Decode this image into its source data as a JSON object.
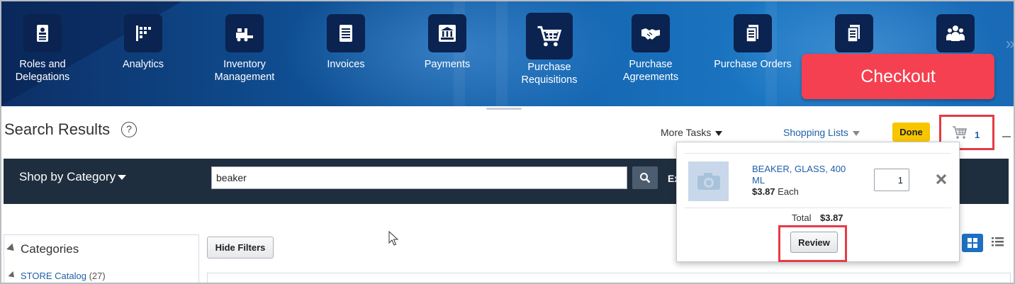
{
  "nav": {
    "items": [
      {
        "label_line1": "Roles and",
        "label_line2": "Delegations",
        "icon": "roles-delegations-icon"
      },
      {
        "label_line1": "Analytics",
        "label_line2": "",
        "icon": "analytics-icon"
      },
      {
        "label_line1": "Inventory",
        "label_line2": "Management",
        "icon": "inventory-icon"
      },
      {
        "label_line1": "Invoices",
        "label_line2": "",
        "icon": "invoices-icon"
      },
      {
        "label_line1": "Payments",
        "label_line2": "",
        "icon": "payments-icon"
      },
      {
        "label_line1": "Purchase",
        "label_line2": "Requisitions",
        "icon": "cart-icon"
      },
      {
        "label_line1": "Purchase",
        "label_line2": "Agreements",
        "icon": "handshake-icon"
      },
      {
        "label_line1": "Purchase Orders",
        "label_line2": "",
        "icon": "document-icon"
      },
      {
        "label_line1": "",
        "label_line2": "",
        "icon": "document-icon"
      },
      {
        "label_line1": "",
        "label_line2": "",
        "icon": "team-icon"
      }
    ],
    "more_glyph": "»"
  },
  "annotation": {
    "checkout_label": "Checkout"
  },
  "header": {
    "title": "Search Results",
    "help_glyph": "?",
    "more_tasks": "More Tasks",
    "shopping_lists": "Shopping Lists",
    "done": "Done",
    "cart_count": "1"
  },
  "search": {
    "category_label": "Shop by Category",
    "value": "beaker",
    "extra_label": "Ex"
  },
  "filters": {
    "hide_filters": "Hide Filters",
    "categories_title": "Categories",
    "items": [
      {
        "label": "STORE Catalog",
        "count": "(27)"
      }
    ]
  },
  "cart_popup": {
    "item": {
      "name": "BEAKER, GLASS, 400 ML",
      "price": "$3.87",
      "unit": "Each",
      "quantity": "1"
    },
    "total_label": "Total",
    "total_value": "$3.87",
    "review": "Review"
  },
  "colors": {
    "banner_dark": "#0a2350",
    "checkout": "#f44050",
    "done": "#f7c600",
    "highlight": "#e53b46",
    "link": "#1f5fa8",
    "searchbar": "#1f2e3e"
  }
}
